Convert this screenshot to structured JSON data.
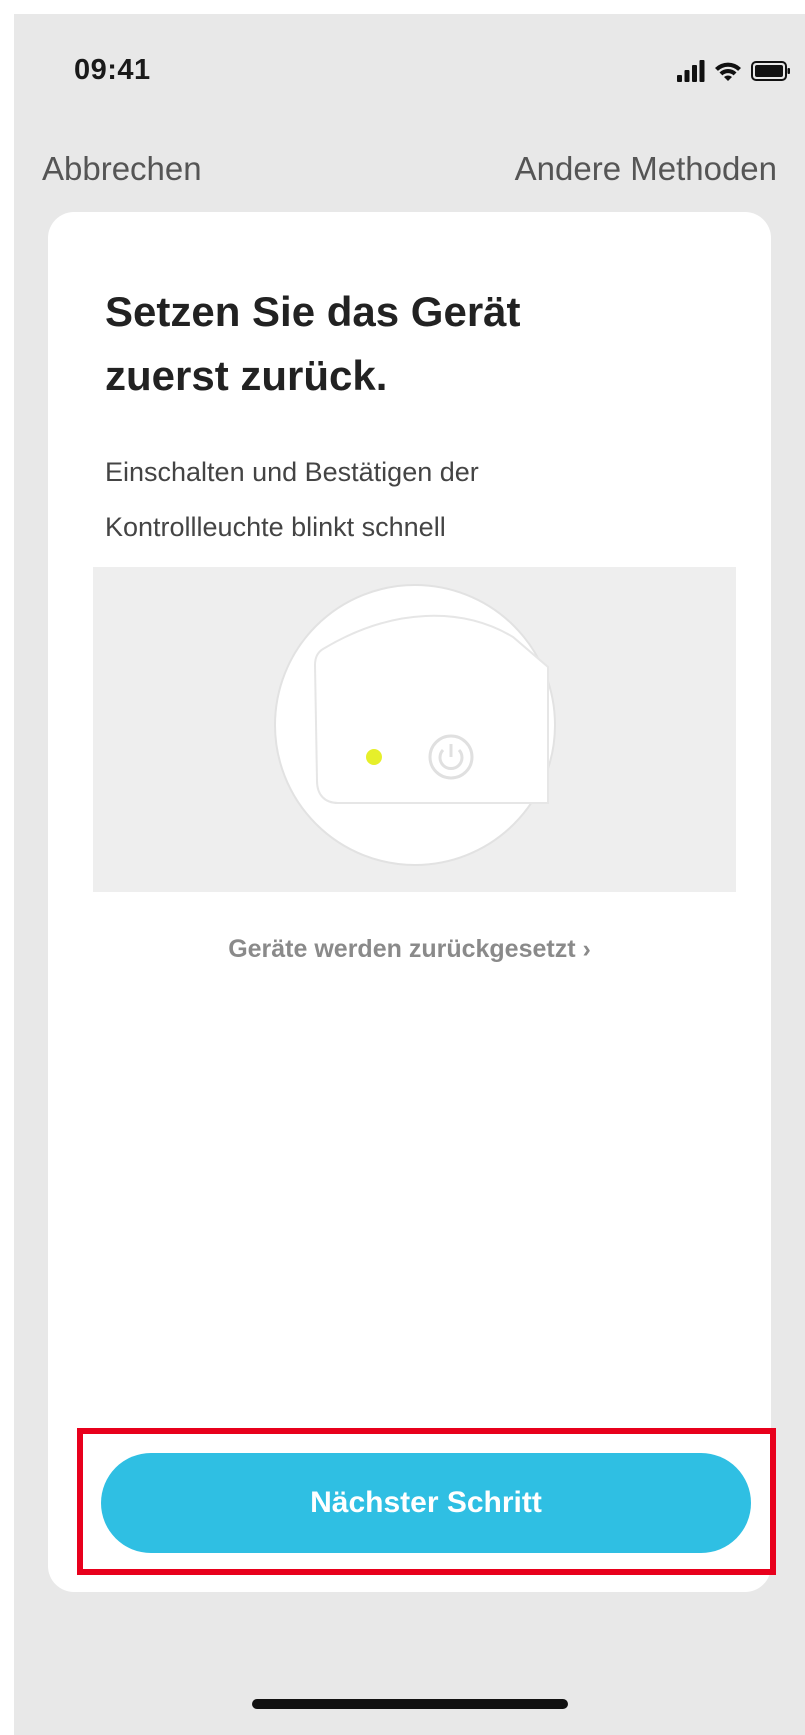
{
  "status_bar": {
    "time": "09:41",
    "icons": [
      "cellular-signal-icon",
      "wifi-icon",
      "battery-icon"
    ]
  },
  "nav": {
    "cancel_label": "Abbrechen",
    "other_methods_label": "Andere Methoden"
  },
  "card": {
    "title_line1": "Setzen Sie das Gerät",
    "title_line2": "zuerst zurück.",
    "description_line1": "Einschalten und Bestätigen der",
    "description_line2": "Kontrollleuchte blinkt schnell",
    "illustration_icons": [
      "device-plug-icon",
      "indicator-light-icon",
      "power-button-icon"
    ],
    "reset_link_label": "Geräte werden zurückgesetzt",
    "reset_link_chevron": "›"
  },
  "footer": {
    "next_button_label": "Nächster Schritt"
  },
  "colors": {
    "screen_background": "#e8e8e8",
    "card_background": "#ffffff",
    "button_accent": "#2fbfe3",
    "highlight_frame": "#e8001c",
    "indicator_light": "#e6ef2a"
  }
}
